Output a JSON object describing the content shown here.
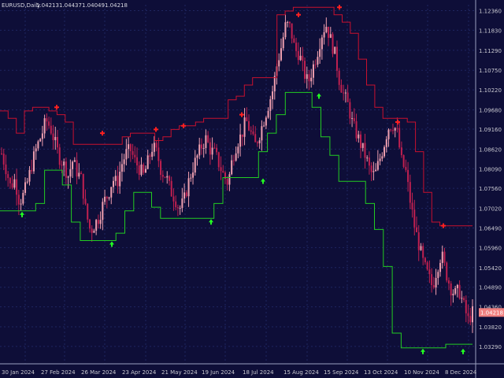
{
  "header": {
    "symbol": "EURUSD,Daily",
    "open": "1.04213",
    "high": "1.04437",
    "low": "1.04049",
    "close": "1.04218"
  },
  "colors": {
    "background": "#0e0e38",
    "grid": "#1f2560",
    "candle": "#f0a0b0",
    "candle_alt": "#c02050",
    "upper_channel": "#c8102e",
    "lower_channel": "#22cc22",
    "sell_arrow": "#ff2020",
    "buy_arrow": "#22ff22",
    "price_badge": "#f08080",
    "axis_text": "#c8c8d0"
  },
  "chart_data": {
    "type": "candlestick",
    "instrument": "EURUSD",
    "timeframe": "Daily",
    "current_price": 1.04218,
    "ylim": [
      1.0282,
      1.1252
    ],
    "y_ticks": [
      "1.12360",
      "1.11830",
      "1.11290",
      "1.10750",
      "1.10220",
      "1.09680",
      "1.09160",
      "1.08620",
      "1.08090",
      "1.07560",
      "1.07020",
      "1.06490",
      "1.05960",
      "1.05420",
      "1.04890",
      "1.04360",
      "1.03820",
      "1.03290"
    ],
    "x_ticks": [
      "30 Jan 2024",
      "27 Feb 2024",
      "26 Mar 2024",
      "23 Apr 2024",
      "21 May 2024",
      "19 Jun 2024",
      "18 Jul 2024",
      "15 Aug 2024",
      "15 Sep 2024",
      "13 Oct 2024",
      "10 Nov 2024",
      "8 Dec 2024"
    ],
    "close_path": [
      1.085,
      1.081,
      1.076,
      1.078,
      1.072,
      1.074,
      1.078,
      1.083,
      1.087,
      1.09,
      1.094,
      1.092,
      1.088,
      1.084,
      1.082,
      1.079,
      1.083,
      1.08,
      1.078,
      1.069,
      1.064,
      1.066,
      1.068,
      1.072,
      1.074,
      1.078,
      1.077,
      1.082,
      1.085,
      1.086,
      1.083,
      1.081,
      1.079,
      1.083,
      1.087,
      1.085,
      1.08,
      1.079,
      1.075,
      1.073,
      1.07,
      1.072,
      1.077,
      1.081,
      1.084,
      1.087,
      1.089,
      1.086,
      1.085,
      1.082,
      1.079,
      1.077,
      1.084,
      1.088,
      1.09,
      1.094,
      1.091,
      1.087,
      1.09,
      1.094,
      1.098,
      1.102,
      1.109,
      1.114,
      1.12,
      1.119,
      1.113,
      1.112,
      1.107,
      1.104,
      1.108,
      1.112,
      1.117,
      1.12,
      1.116,
      1.112,
      1.105,
      1.101,
      1.098,
      1.093,
      1.09,
      1.087,
      1.084,
      1.08,
      1.079,
      1.083,
      1.087,
      1.092,
      1.093,
      1.091,
      1.083,
      1.08,
      1.072,
      1.065,
      1.06,
      1.055,
      1.052,
      1.049,
      1.054,
      1.058,
      1.053,
      1.049,
      1.047,
      1.048,
      1.044,
      1.04,
      1.042
    ],
    "upper_channel": [
      1.0965,
      1.0945,
      1.0905,
      1.0965,
      1.0975,
      1.0975,
      1.0965,
      1.0955,
      1.0935,
      1.0875,
      1.0875,
      1.0875,
      1.0875,
      1.0875,
      1.0875,
      1.0895,
      1.0905,
      1.0905,
      1.0905,
      1.0885,
      1.0895,
      1.0915,
      1.0925,
      1.0925,
      1.0935,
      1.0945,
      1.0945,
      1.0945,
      1.0995,
      1.1005,
      1.1035,
      1.1055,
      1.1055,
      1.1055,
      1.1225,
      1.1235,
      1.1245,
      1.1245,
      1.1245,
      1.1245,
      1.1245,
      1.1225,
      1.1205,
      1.1175,
      1.1105,
      1.1035,
      1.0975,
      1.0945,
      1.0945,
      1.0945,
      1.0935,
      1.0855,
      1.0745,
      1.0665,
      1.0655,
      1.0655,
      1.0655,
      1.0655
    ],
    "lower_channel": [
      1.0695,
      1.0695,
      1.0695,
      1.0695,
      1.0715,
      1.0805,
      1.0805,
      1.0765,
      1.0665,
      1.0615,
      1.0615,
      1.0615,
      1.0615,
      1.0635,
      1.0695,
      1.0745,
      1.0745,
      1.0705,
      1.0675,
      1.0675,
      1.0675,
      1.0675,
      1.0675,
      1.0675,
      1.0715,
      1.0785,
      1.0785,
      1.0785,
      1.0785,
      1.0855,
      1.0905,
      1.0955,
      1.1015,
      1.1015,
      1.1015,
      1.0975,
      1.0895,
      1.0845,
      1.0775,
      1.0775,
      1.0775,
      1.0715,
      1.0645,
      1.0545,
      1.0365,
      1.0325,
      1.0325,
      1.0325,
      1.0325,
      1.0325,
      1.0335,
      1.0335,
      1.0335
    ],
    "sell_signals": [
      [
        72,
        1.0975
      ],
      [
        130,
        1.0905
      ],
      [
        198,
        1.0915
      ],
      [
        233,
        1.0925
      ],
      [
        307,
        1.0955
      ],
      [
        379,
        1.1225
      ],
      [
        431,
        1.1245
      ],
      [
        505,
        1.0935
      ],
      [
        563,
        1.0655
      ]
    ],
    "buy_signals": [
      [
        28,
        1.0695
      ],
      [
        142,
        1.0615
      ],
      [
        268,
        1.0675
      ],
      [
        334,
        1.0785
      ],
      [
        405,
        1.1015
      ],
      [
        537,
        1.0325
      ],
      [
        588,
        1.0325
      ]
    ]
  }
}
